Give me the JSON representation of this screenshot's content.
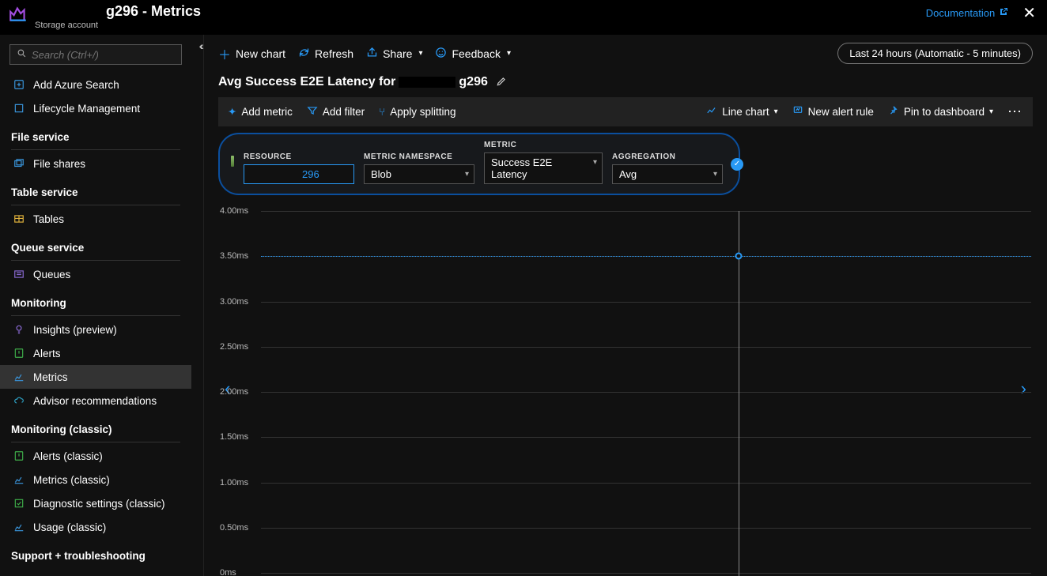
{
  "header": {
    "title_suffix": "g296 - Metrics",
    "subtitle": "Storage account",
    "doc_link": "Documentation"
  },
  "search": {
    "placeholder": "Search (Ctrl+/)"
  },
  "sidebar": {
    "top_items": [
      {
        "label": "Add Azure Search",
        "icon": "plus",
        "color": "#3a96dd"
      },
      {
        "label": "Lifecycle Management",
        "icon": "box",
        "color": "#3a96dd"
      }
    ],
    "groups": [
      {
        "title": "File service",
        "items": [
          {
            "label": "File shares",
            "icon": "files",
            "color": "#3a96dd"
          }
        ]
      },
      {
        "title": "Table service",
        "items": [
          {
            "label": "Tables",
            "icon": "table",
            "color": "#e2b33c"
          }
        ]
      },
      {
        "title": "Queue service",
        "items": [
          {
            "label": "Queues",
            "icon": "queue",
            "color": "#8c6bd6"
          }
        ]
      },
      {
        "title": "Monitoring",
        "items": [
          {
            "label": "Insights (preview)",
            "icon": "bulb",
            "color": "#8c6bd6"
          },
          {
            "label": "Alerts",
            "icon": "alert",
            "color": "#3fae4a"
          },
          {
            "label": "Metrics",
            "icon": "metrics",
            "color": "#3a96dd",
            "selected": true
          },
          {
            "label": "Advisor recommendations",
            "icon": "cloud",
            "color": "#2ea3c7"
          }
        ]
      },
      {
        "title": "Monitoring (classic)",
        "items": [
          {
            "label": "Alerts (classic)",
            "icon": "alert",
            "color": "#3fae4a"
          },
          {
            "label": "Metrics (classic)",
            "icon": "metrics",
            "color": "#3a96dd"
          },
          {
            "label": "Diagnostic settings (classic)",
            "icon": "diag",
            "color": "#3fae4a"
          },
          {
            "label": "Usage (classic)",
            "icon": "metrics",
            "color": "#3a96dd"
          }
        ]
      },
      {
        "title": "Support + troubleshooting",
        "items": []
      }
    ]
  },
  "toolbar": {
    "new_chart": "New chart",
    "refresh": "Refresh",
    "share": "Share",
    "feedback": "Feedback",
    "time_range": "Last 24 hours (Automatic - 5 minutes)"
  },
  "chart_title": {
    "prefix": "Avg Success E2E Latency for ",
    "suffix": "g296"
  },
  "chart_toolbar": {
    "add_metric": "Add metric",
    "add_filter": "Add filter",
    "apply_splitting": "Apply splitting",
    "chart_type": "Line chart",
    "new_alert": "New alert rule",
    "pin": "Pin to dashboard"
  },
  "picker": {
    "resource_label": "RESOURCE",
    "resource_value": "296",
    "namespace_label": "METRIC NAMESPACE",
    "namespace_value": "Blob",
    "metric_label": "METRIC",
    "metric_value": "Success E2E Latency",
    "agg_label": "AGGREGATION",
    "agg_value": "Avg"
  },
  "chart_data": {
    "type": "line",
    "title": "Avg Success E2E Latency",
    "ylabel": "ms",
    "ylim": [
      0,
      4.0
    ],
    "yticks": [
      "4.00ms",
      "3.50ms",
      "3.00ms",
      "2.50ms",
      "2.00ms",
      "1.50ms",
      "1.00ms",
      "0.50ms",
      "0ms"
    ],
    "series": [
      {
        "name": "Success E2E Latency (Avg)",
        "value_constant": 3.5
      }
    ],
    "hover_x_fraction": 0.62
  }
}
